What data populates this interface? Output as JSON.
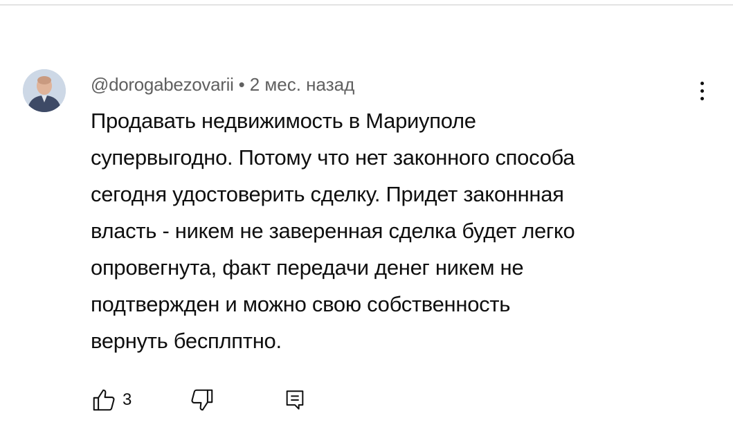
{
  "comment": {
    "author": "@dorogabezovarii",
    "separator": "•",
    "time": "2 мес. назад",
    "text_lines": [
      "Продавать недвижимость в Мариуполе",
      "супервыгодно. Потому что нет законного способа",
      "сегодня удостоверить сделку. Придет законнная",
      "власть - никем не заверенная сделка будет легко",
      "опровегнута, факт передачи денег никем не",
      "подтвержден и можно свою собственность",
      "вернуть бесплптно."
    ],
    "like_count": "3"
  },
  "icons": {
    "like": "thumbs-up-icon",
    "dislike": "thumbs-down-icon",
    "reply": "reply-icon",
    "menu": "more-vert-icon"
  },
  "colors": {
    "text": "#0f0f0f",
    "meta": "#606060",
    "divider": "#e3e3e3"
  }
}
